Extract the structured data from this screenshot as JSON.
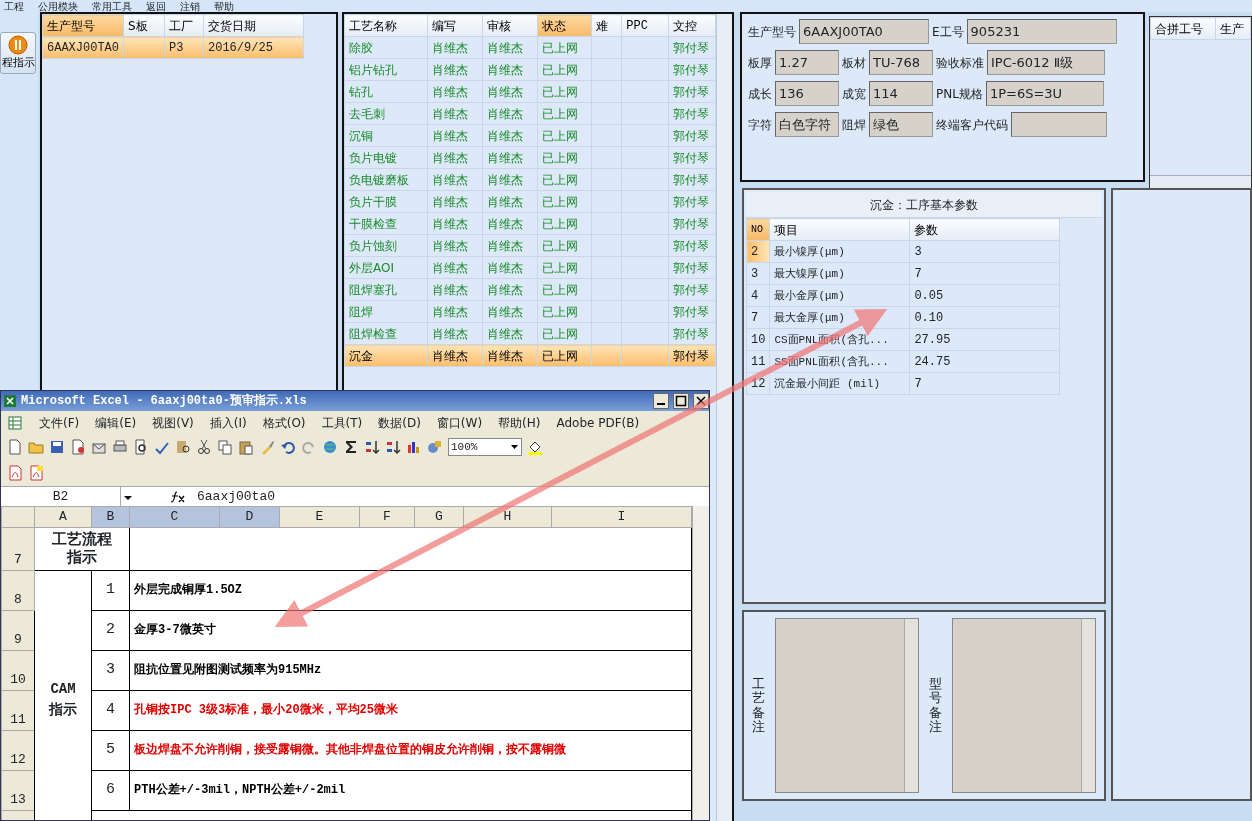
{
  "menu": [
    "工程",
    "公用模块",
    "常用工具",
    "返回",
    "注销",
    "帮助"
  ],
  "side_button": {
    "label": "程指示"
  },
  "orders": {
    "columns": [
      "生产型号",
      "S板",
      "工厂",
      "交货日期"
    ],
    "rows": [
      {
        "cells": [
          "6AAXJ00TA0",
          "",
          "P3",
          "2016/9/25"
        ],
        "selected": true
      }
    ]
  },
  "process": {
    "columns": [
      {
        "label": "工艺名称",
        "sorted": false
      },
      {
        "label": "编写",
        "sorted": false
      },
      {
        "label": "审核",
        "sorted": false
      },
      {
        "label": "状态",
        "sorted": true
      },
      {
        "label": "难",
        "sorted": false
      },
      {
        "label": "PPC",
        "sorted": false
      },
      {
        "label": "文控",
        "sorted": false
      }
    ],
    "rows": [
      {
        "cells": [
          "除胶",
          "肖维杰",
          "肖维杰",
          "已上网",
          "",
          "",
          "郭付琴"
        ],
        "selected": false
      },
      {
        "cells": [
          "铝片钻孔",
          "肖维杰",
          "肖维杰",
          "已上网",
          "",
          "",
          "郭付琴"
        ],
        "selected": false
      },
      {
        "cells": [
          "钻孔",
          "肖维杰",
          "肖维杰",
          "已上网",
          "",
          "",
          "郭付琴"
        ],
        "selected": false
      },
      {
        "cells": [
          "去毛刺",
          "肖维杰",
          "肖维杰",
          "已上网",
          "",
          "",
          "郭付琴"
        ],
        "selected": false
      },
      {
        "cells": [
          "沉铜",
          "肖维杰",
          "肖维杰",
          "已上网",
          "",
          "",
          "郭付琴"
        ],
        "selected": false
      },
      {
        "cells": [
          "负片电镀",
          "肖维杰",
          "肖维杰",
          "已上网",
          "",
          "",
          "郭付琴"
        ],
        "selected": false
      },
      {
        "cells": [
          "负电镀磨板",
          "肖维杰",
          "肖维杰",
          "已上网",
          "",
          "",
          "郭付琴"
        ],
        "selected": false
      },
      {
        "cells": [
          "负片干膜",
          "肖维杰",
          "肖维杰",
          "已上网",
          "",
          "",
          "郭付琴"
        ],
        "selected": false
      },
      {
        "cells": [
          "干膜检查",
          "肖维杰",
          "肖维杰",
          "已上网",
          "",
          "",
          "郭付琴"
        ],
        "selected": false
      },
      {
        "cells": [
          "负片蚀刻",
          "肖维杰",
          "肖维杰",
          "已上网",
          "",
          "",
          "郭付琴"
        ],
        "selected": false
      },
      {
        "cells": [
          "外层AOI",
          "肖维杰",
          "肖维杰",
          "已上网",
          "",
          "",
          "郭付琴"
        ],
        "selected": false
      },
      {
        "cells": [
          "阻焊塞孔",
          "肖维杰",
          "肖维杰",
          "已上网",
          "",
          "",
          "郭付琴"
        ],
        "selected": false
      },
      {
        "cells": [
          "阻焊",
          "肖维杰",
          "肖维杰",
          "已上网",
          "",
          "",
          "郭付琴"
        ],
        "selected": false
      },
      {
        "cells": [
          "阻焊检查",
          "肖维杰",
          "肖维杰",
          "已上网",
          "",
          "",
          "郭付琴"
        ],
        "selected": false
      },
      {
        "cells": [
          "沉金",
          "肖维杰",
          "肖维杰",
          "已上网",
          "",
          "",
          "郭付琴"
        ],
        "selected": true
      }
    ]
  },
  "form": [
    [
      {
        "label": "生产型号",
        "value": "6AAXJ00TA0"
      },
      {
        "label": "E工号",
        "value": "905231"
      }
    ],
    [
      {
        "label": "板厚",
        "value": "1.27"
      },
      {
        "label": "板材",
        "value": "TU-768"
      },
      {
        "label": "验收标准",
        "value": "IPC-6012 Ⅱ级"
      }
    ],
    [
      {
        "label": "成长",
        "value": "136"
      },
      {
        "label": "成宽",
        "value": "114"
      },
      {
        "label": "PNL规格",
        "value": "1P=6S=3U"
      }
    ],
    [
      {
        "label": "字符",
        "value": "白色字符"
      },
      {
        "label": "阻焊",
        "value": "绿色"
      },
      {
        "label": "终端客户代码"
      }
    ]
  ],
  "merge_table": {
    "columns": [
      "合拼工号",
      "生产"
    ]
  },
  "params": {
    "title": "沉金：工序基本参数",
    "columns": [
      "NO",
      "项目",
      "参数"
    ],
    "rows": [
      {
        "no": "2",
        "item": "最小镍厚(μm)",
        "value": "3",
        "selected": true
      },
      {
        "no": "3",
        "item": "最大镍厚(μm)",
        "value": "7",
        "selected": false
      },
      {
        "no": "4",
        "item": "最小金厚(μm)",
        "value": "0.05",
        "selected": false
      },
      {
        "no": "7",
        "item": "最大金厚(μm)",
        "value": "0.10",
        "selected": false
      },
      {
        "no": "10",
        "item": "CS面PNL面积(含孔...",
        "value": "27.95",
        "selected": false
      },
      {
        "no": "11",
        "item": "SS面PNL面积(含孔...",
        "value": "24.75",
        "selected": false
      },
      {
        "no": "12",
        "item": "沉金最小间距 (mil)",
        "value": "7",
        "selected": false
      }
    ]
  },
  "remarks": [
    {
      "label": "工艺备注"
    },
    {
      "label": "型号备注"
    }
  ],
  "excel": {
    "title": "Microsoft Excel - 6aaxj00ta0-预审指示.xls",
    "menu": [
      "文件(F)",
      "编辑(E)",
      "视图(V)",
      "插入(I)",
      "格式(O)",
      "工具(T)",
      "数据(D)",
      "窗口(W)",
      "帮助(H)",
      "Adobe PDF(B)"
    ],
    "zoom": "100%",
    "name_box": "B2",
    "formula": "6aaxj00ta0",
    "columns": [
      {
        "label": "A",
        "selected": false
      },
      {
        "label": "B",
        "selected": true
      },
      {
        "label": "C",
        "selected": true
      },
      {
        "label": "D",
        "selected": true
      },
      {
        "label": "E",
        "selected": false
      },
      {
        "label": "F",
        "selected": false
      },
      {
        "label": "G",
        "selected": false
      },
      {
        "label": "H",
        "selected": false
      },
      {
        "label": "I",
        "selected": false
      }
    ],
    "header_row": {
      "row": "7",
      "label": "工艺流程指示"
    },
    "group": "CAM指示",
    "items": [
      {
        "row": "8",
        "no": "1",
        "text": "外层完成铜厚1.5OZ",
        "color": "#000000"
      },
      {
        "row": "9",
        "no": "2",
        "text": "金厚3-7微英寸",
        "color": "#000000"
      },
      {
        "row": "10",
        "no": "3",
        "text": "阻抗位置见附图测试频率为915MHz",
        "color": "#000000"
      },
      {
        "row": "11",
        "no": "4",
        "text": "孔铜按IPC 3级3标准，最小20微米，平均25微米",
        "color": "#e00000"
      },
      {
        "row": "12",
        "no": "5",
        "text": "板边焊盘不允许削铜，接受露铜微。其他非焊盘位置的铜皮允许削铜，按不露铜微",
        "color": "#e00000"
      },
      {
        "row": "13",
        "no": "6",
        "text": "PTH公差+/-3mil，NPTH公差+/-2mil",
        "color": "#000000"
      }
    ]
  }
}
